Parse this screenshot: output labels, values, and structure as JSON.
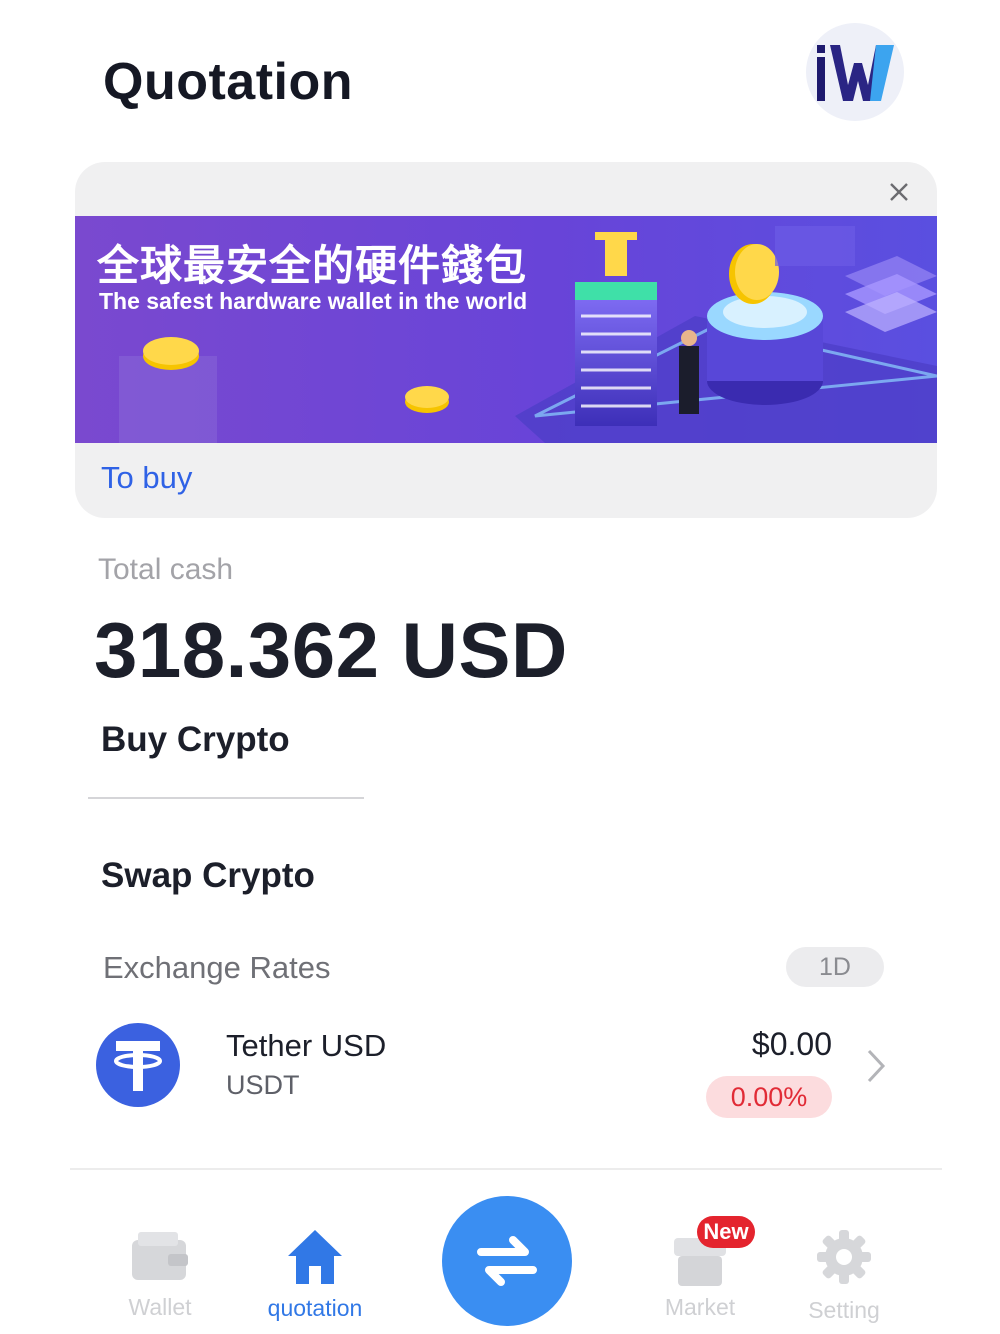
{
  "header": {
    "title": "Quotation",
    "avatar_icon": "iw-logo-icon"
  },
  "banner": {
    "close_icon": "close-icon",
    "headline_cn": "全球最安全的硬件錢包",
    "headline_en": "The safest hardware wallet in the world",
    "cta": "To buy",
    "colors": {
      "background": "#6a43d6",
      "accent": "#2f62e6"
    }
  },
  "balance": {
    "label": "Total cash",
    "value": "318.362 USD"
  },
  "actions": {
    "buy": "Buy Crypto",
    "swap": "Swap Crypto"
  },
  "rates": {
    "label": "Exchange Rates",
    "period": "1D",
    "assets": [
      {
        "name": "Tether USD",
        "symbol": "USDT",
        "price": "$0.00",
        "change": "0.00%",
        "icon": "tether-icon",
        "icon_color": "#3b61e0"
      }
    ]
  },
  "nav": {
    "wallet": "Wallet",
    "quotation": "quotation",
    "swap_icon": "swap-arrows-icon",
    "market": "Market",
    "market_badge": "New",
    "setting": "Setting",
    "active_color": "#3178e6"
  }
}
